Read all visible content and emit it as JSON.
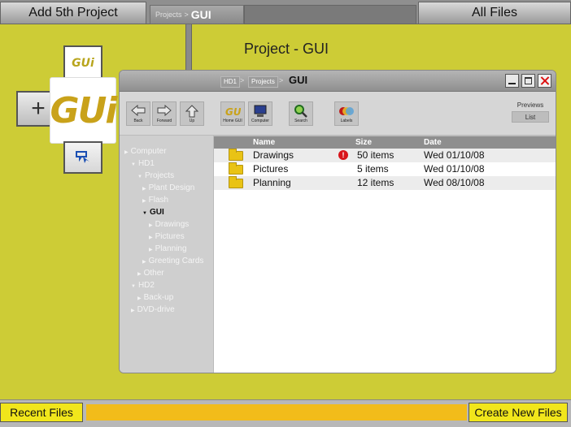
{
  "topbar": {
    "add_project": "Add 5th Project",
    "crumb_parent": "Projects",
    "crumb_sep": ">",
    "crumb_current": "GUI",
    "all_files": "All Files"
  },
  "project_title": "Project - GUI",
  "dock": {
    "add_symbol": "+",
    "small_logo": "GUi",
    "big_logo": "GUi"
  },
  "window": {
    "breadcrumb": [
      "HD1",
      "Projects",
      "GUI"
    ],
    "crumb_sep": ">",
    "controls": [
      "minimize-icon",
      "maximize-icon",
      "close-icon"
    ]
  },
  "toolbar": {
    "buttons": [
      {
        "label": "Back",
        "icon": "back-arrow-icon"
      },
      {
        "label": "Forward",
        "icon": "forward-arrow-icon"
      },
      {
        "label": "Up",
        "icon": "up-arrow-icon"
      },
      {
        "label": "Home GUI",
        "icon": "home-gui-icon"
      },
      {
        "label": "Computer",
        "icon": "computer-icon"
      },
      {
        "label": "Search",
        "icon": "magnifier-icon"
      },
      {
        "label": "Labels",
        "icon": "labels-icon"
      }
    ],
    "view_previews": "Previews",
    "view_list": "List"
  },
  "sidebar": {
    "items": [
      {
        "label": "Computer",
        "level": 0,
        "selected": false
      },
      {
        "label": "HD1",
        "level": 1,
        "selected": false
      },
      {
        "label": "Projects",
        "level": 2,
        "selected": false
      },
      {
        "label": "Plant Design",
        "level": 3,
        "selected": false
      },
      {
        "label": "Flash",
        "level": 3,
        "selected": false
      },
      {
        "label": "GUI",
        "level": 3,
        "selected": true
      },
      {
        "label": "Drawings",
        "level": 4,
        "selected": false
      },
      {
        "label": "Pictures",
        "level": 4,
        "selected": false
      },
      {
        "label": "Planning",
        "level": 4,
        "selected": false
      },
      {
        "label": "Greeting Cards",
        "level": 3,
        "selected": false
      },
      {
        "label": "Other",
        "level": 2,
        "selected": false
      },
      {
        "label": "HD2",
        "level": 1,
        "selected": false
      },
      {
        "label": "Back-up",
        "level": 2,
        "selected": false
      },
      {
        "label": "DVD-drive",
        "level": 1,
        "selected": false
      }
    ]
  },
  "list": {
    "headers": {
      "name": "Name",
      "size": "Size",
      "date": "Date"
    },
    "rows": [
      {
        "name": "Drawings",
        "size": "50 items",
        "date": "Wed 01/10/08",
        "alert": true
      },
      {
        "name": "Pictures",
        "size": "5 items",
        "date": "Wed 01/10/08",
        "alert": false
      },
      {
        "name": "Planning",
        "size": "12 items",
        "date": "Wed 08/10/08",
        "alert": false
      }
    ]
  },
  "bottombar": {
    "recent_files": "Recent Files",
    "create_new_files": "Create New Files"
  },
  "colors": {
    "background": "#cdcc36",
    "bottom_buttons": "#f1e61b",
    "bottom_strip": "#f2bc1a",
    "folder": "#e9c315",
    "alert": "#d8141a",
    "logo": "#c9a21a"
  }
}
